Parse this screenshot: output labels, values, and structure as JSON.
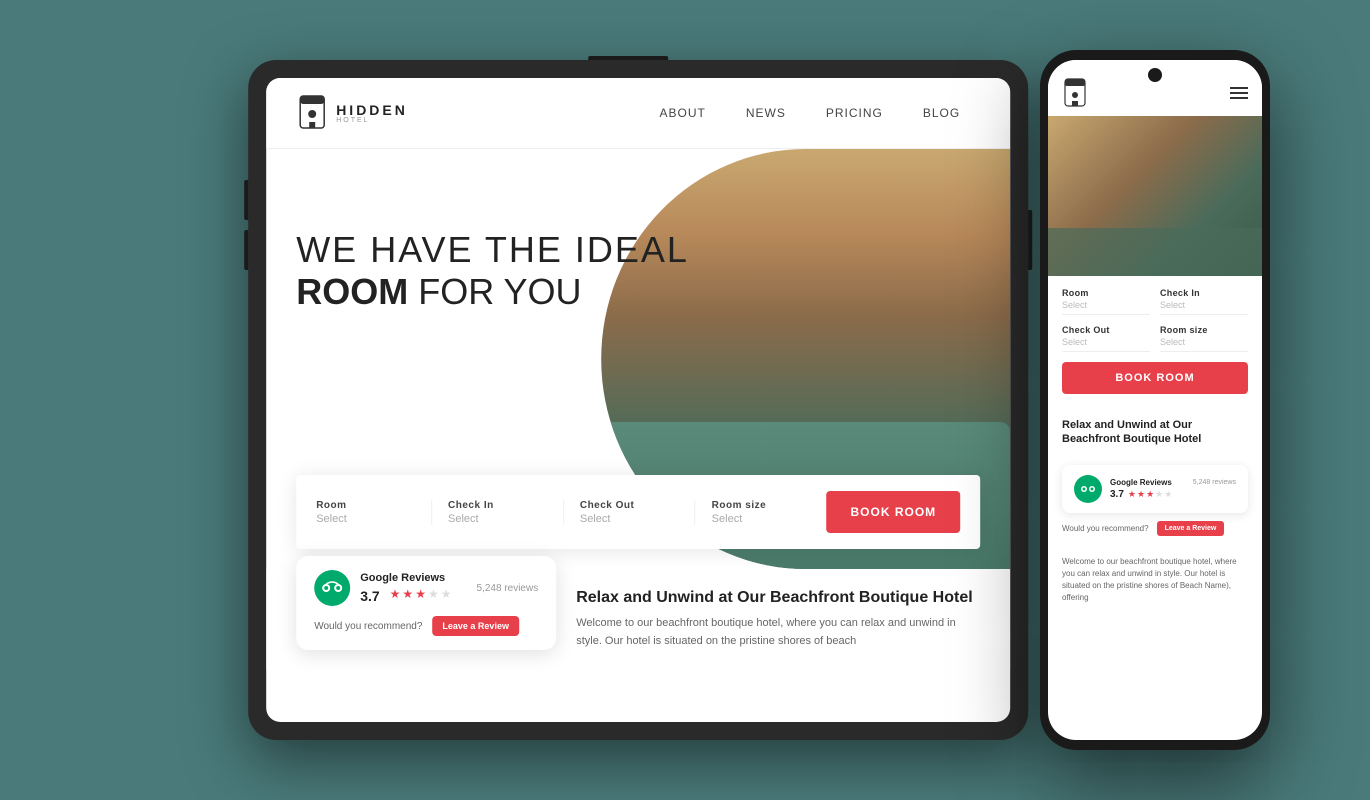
{
  "brand": {
    "name": "HIDDEN",
    "subtitle": "HOTEL",
    "logo_symbol": "🏨"
  },
  "nav": {
    "items": [
      "ABOUT",
      "NEWS",
      "PRICING",
      "BLOG"
    ]
  },
  "hero": {
    "line1": "WE HAVE THE IDEAL",
    "line2_bold": "ROOM",
    "line2_rest": " FOR YOU"
  },
  "booking": {
    "fields": [
      {
        "label": "Room",
        "value": "Select"
      },
      {
        "label": "Check In",
        "value": "Select"
      },
      {
        "label": "Check Out",
        "value": "Select"
      },
      {
        "label": "Room size",
        "value": "Select"
      }
    ],
    "button_label": "BOOK ROOM"
  },
  "review": {
    "source": "Google Reviews",
    "count": "5,248 reviews",
    "rating": "3.7",
    "stars_filled": 3,
    "stars_empty": 2,
    "recommend_text": "Would you recommend?",
    "cta_label": "Leave a Review"
  },
  "below_fold": {
    "title": "Relax and Unwind at Our Beachfront Boutique Hotel",
    "text": "Welcome to our beachfront boutique hotel, where you can relax and unwind in style. Our hotel is situated on the pristine shores of beach"
  },
  "phone": {
    "booking": {
      "fields": [
        {
          "label": "Room",
          "value": "Select"
        },
        {
          "label": "Check In",
          "value": "Select"
        },
        {
          "label": "Check Out",
          "value": "Select"
        },
        {
          "label": "Room size",
          "value": "Select"
        }
      ],
      "button_label": "BOOK ROOM"
    },
    "desc": {
      "title": "Relax and Unwind at Our Beachfront Boutique Hotel",
      "text": "Welcome to our beachfront boutique hotel, where you can relax and unwind in style. Our hotel is situated on the pristine shores of Beach Name), offering"
    },
    "review": {
      "source": "Google Reviews",
      "count": "5,248 reviews",
      "rating": "3.7",
      "recommend_text": "Would you recommend?",
      "cta_label": "Leave a Review"
    }
  },
  "colors": {
    "accent": "#e8404a",
    "tripadvisor": "#00aa6c",
    "background": "#4a7a7a",
    "dark_device": "#1a1a1a"
  }
}
